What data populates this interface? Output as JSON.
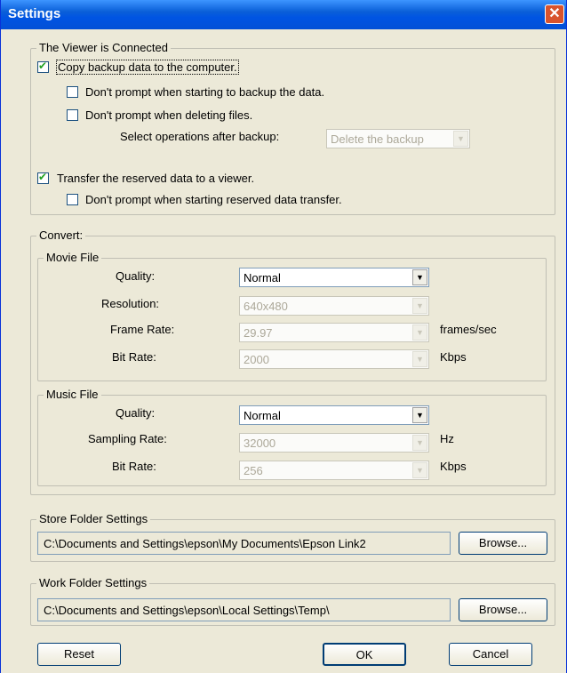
{
  "window": {
    "title": "Settings",
    "close_glyph": "✕"
  },
  "viewer": {
    "legend": "The Viewer is Connected",
    "copy_backup": {
      "label": "Copy backup data to the computer.",
      "checked": true
    },
    "no_prompt_backup": {
      "label": "Don't prompt when starting to backup the data.",
      "checked": false
    },
    "no_prompt_delete": {
      "label": "Don't prompt when deleting files.",
      "checked": false
    },
    "after_backup_label": "Select operations after backup:",
    "after_backup_value": "Delete the backup",
    "transfer_reserved": {
      "label": "Transfer the reserved data to a viewer.",
      "checked": true
    },
    "no_prompt_transfer": {
      "label": "Don't prompt when starting reserved data transfer.",
      "checked": false
    }
  },
  "convert": {
    "legend": "Convert:",
    "movie": {
      "legend": "Movie File",
      "quality_label": "Quality:",
      "quality_value": "Normal",
      "resolution_label": "Resolution:",
      "resolution_value": "640x480",
      "frame_rate_label": "Frame Rate:",
      "frame_rate_value": "29.97",
      "frame_rate_unit": "frames/sec",
      "bit_rate_label": "Bit Rate:",
      "bit_rate_value": "2000",
      "bit_rate_unit": "Kbps"
    },
    "music": {
      "legend": "Music File",
      "quality_label": "Quality:",
      "quality_value": "Normal",
      "sampling_label": "Sampling Rate:",
      "sampling_value": "32000",
      "sampling_unit": "Hz",
      "bit_rate_label": "Bit Rate:",
      "bit_rate_value": "256",
      "bit_rate_unit": "Kbps"
    }
  },
  "store_folder": {
    "legend": "Store Folder Settings",
    "path": "C:\\Documents and Settings\\epson\\My Documents\\Epson Link2",
    "browse": "Browse..."
  },
  "work_folder": {
    "legend": "Work Folder Settings",
    "path": "C:\\Documents and Settings\\epson\\Local Settings\\Temp\\",
    "browse": "Browse..."
  },
  "buttons": {
    "reset": "Reset",
    "ok": "OK",
    "cancel": "Cancel"
  },
  "icons": {
    "dropdown": "▼"
  }
}
